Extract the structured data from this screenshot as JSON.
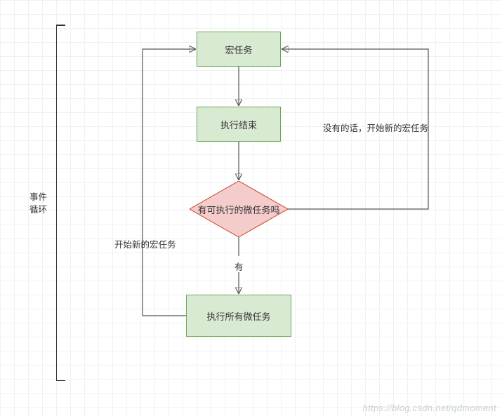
{
  "nodes": {
    "macro_task": "宏任务",
    "exec_end": "执行结束",
    "has_microtask": "有可执行的微任务吗",
    "exec_all_micro": "执行所有微任务"
  },
  "edges": {
    "yes": "有",
    "no_new_macro": "没有的话，开始新的宏任务",
    "start_new_macro": "开始新的宏任务"
  },
  "sidebar": {
    "line1": "事件",
    "line2": "循环"
  },
  "watermark": "https://blog.csdn.net/qdmoment"
}
